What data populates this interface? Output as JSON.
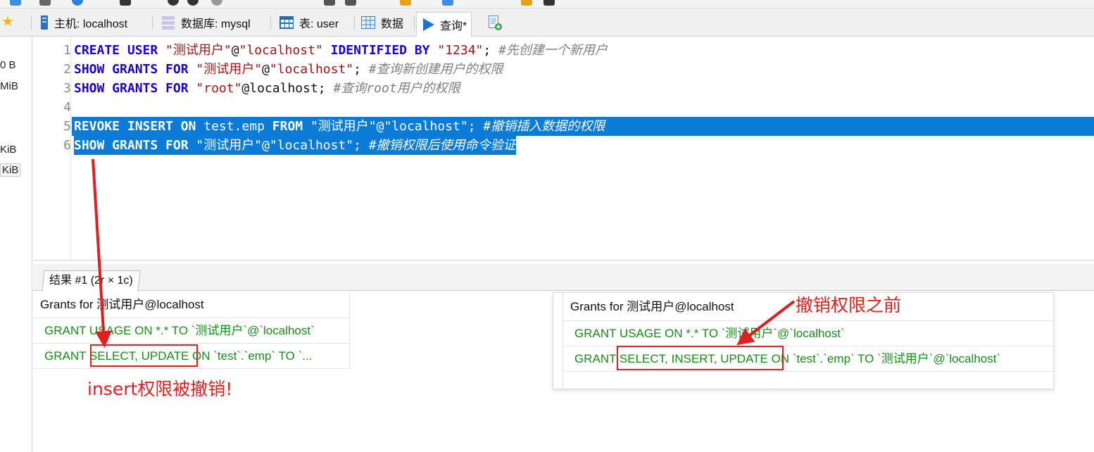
{
  "tabbar": {
    "host_label": "主机: localhost",
    "db_label": "数据库: mysql",
    "table_label": "表: user",
    "data_label": "数据",
    "query_label": "查询*"
  },
  "leftstrip": {
    "values": [
      "0 B",
      "MiB",
      "KiB",
      "KiB"
    ]
  },
  "editor": {
    "lines": [
      {
        "num": "1",
        "parts": [
          "CREATE USER ",
          "\"测试用户\"",
          "@",
          "\"localhost\"",
          " IDENTIFIED BY ",
          "\"1234\"",
          "; ",
          "#先创建一个新用户"
        ]
      },
      {
        "num": "2",
        "parts": [
          "SHOW GRANTS FOR ",
          "\"测试用户\"",
          "@",
          "\"localhost\"",
          "; ",
          "#查询新创建用户的权限"
        ]
      },
      {
        "num": "3",
        "parts": [
          "SHOW GRANTS FOR ",
          "\"root\"",
          "@localhost",
          "; ",
          "#查询root用户的权限"
        ]
      },
      {
        "num": "4",
        "parts": []
      },
      {
        "num": "5",
        "parts": [
          "REVOKE INSERT ON ",
          "test.emp ",
          "FROM ",
          "\"测试用户\"",
          "@",
          "\"localhost\"",
          "; ",
          "#撤销插入数据的权限"
        ]
      },
      {
        "num": "6",
        "parts": [
          "SHOW GRANTS FOR ",
          "\"测试用户\"",
          "@",
          "\"localhost\"",
          "; ",
          "#撤销权限后使用命令验证"
        ]
      }
    ]
  },
  "results": {
    "tab_label": "结果 #1 (2r × 1c)",
    "header": "Grants for 测试用户@localhost",
    "rows": [
      "GRANT USAGE ON *.* TO `测试用户`@`localhost`",
      "GRANT SELECT, UPDATE ON `test`.`emp` TO `..."
    ]
  },
  "previous": {
    "header": "Grants for 测试用户@localhost",
    "rows": [
      "GRANT USAGE ON *.* TO `测试用户`@`localhost`",
      "GRANT SELECT, INSERT, UPDATE ON `test`.`emp` TO `测试用户`@`localhost`"
    ]
  },
  "annotations": {
    "revoked_note": "insert权限被撤销!",
    "before_note": "撤销权限之前",
    "color": "#e02020"
  }
}
